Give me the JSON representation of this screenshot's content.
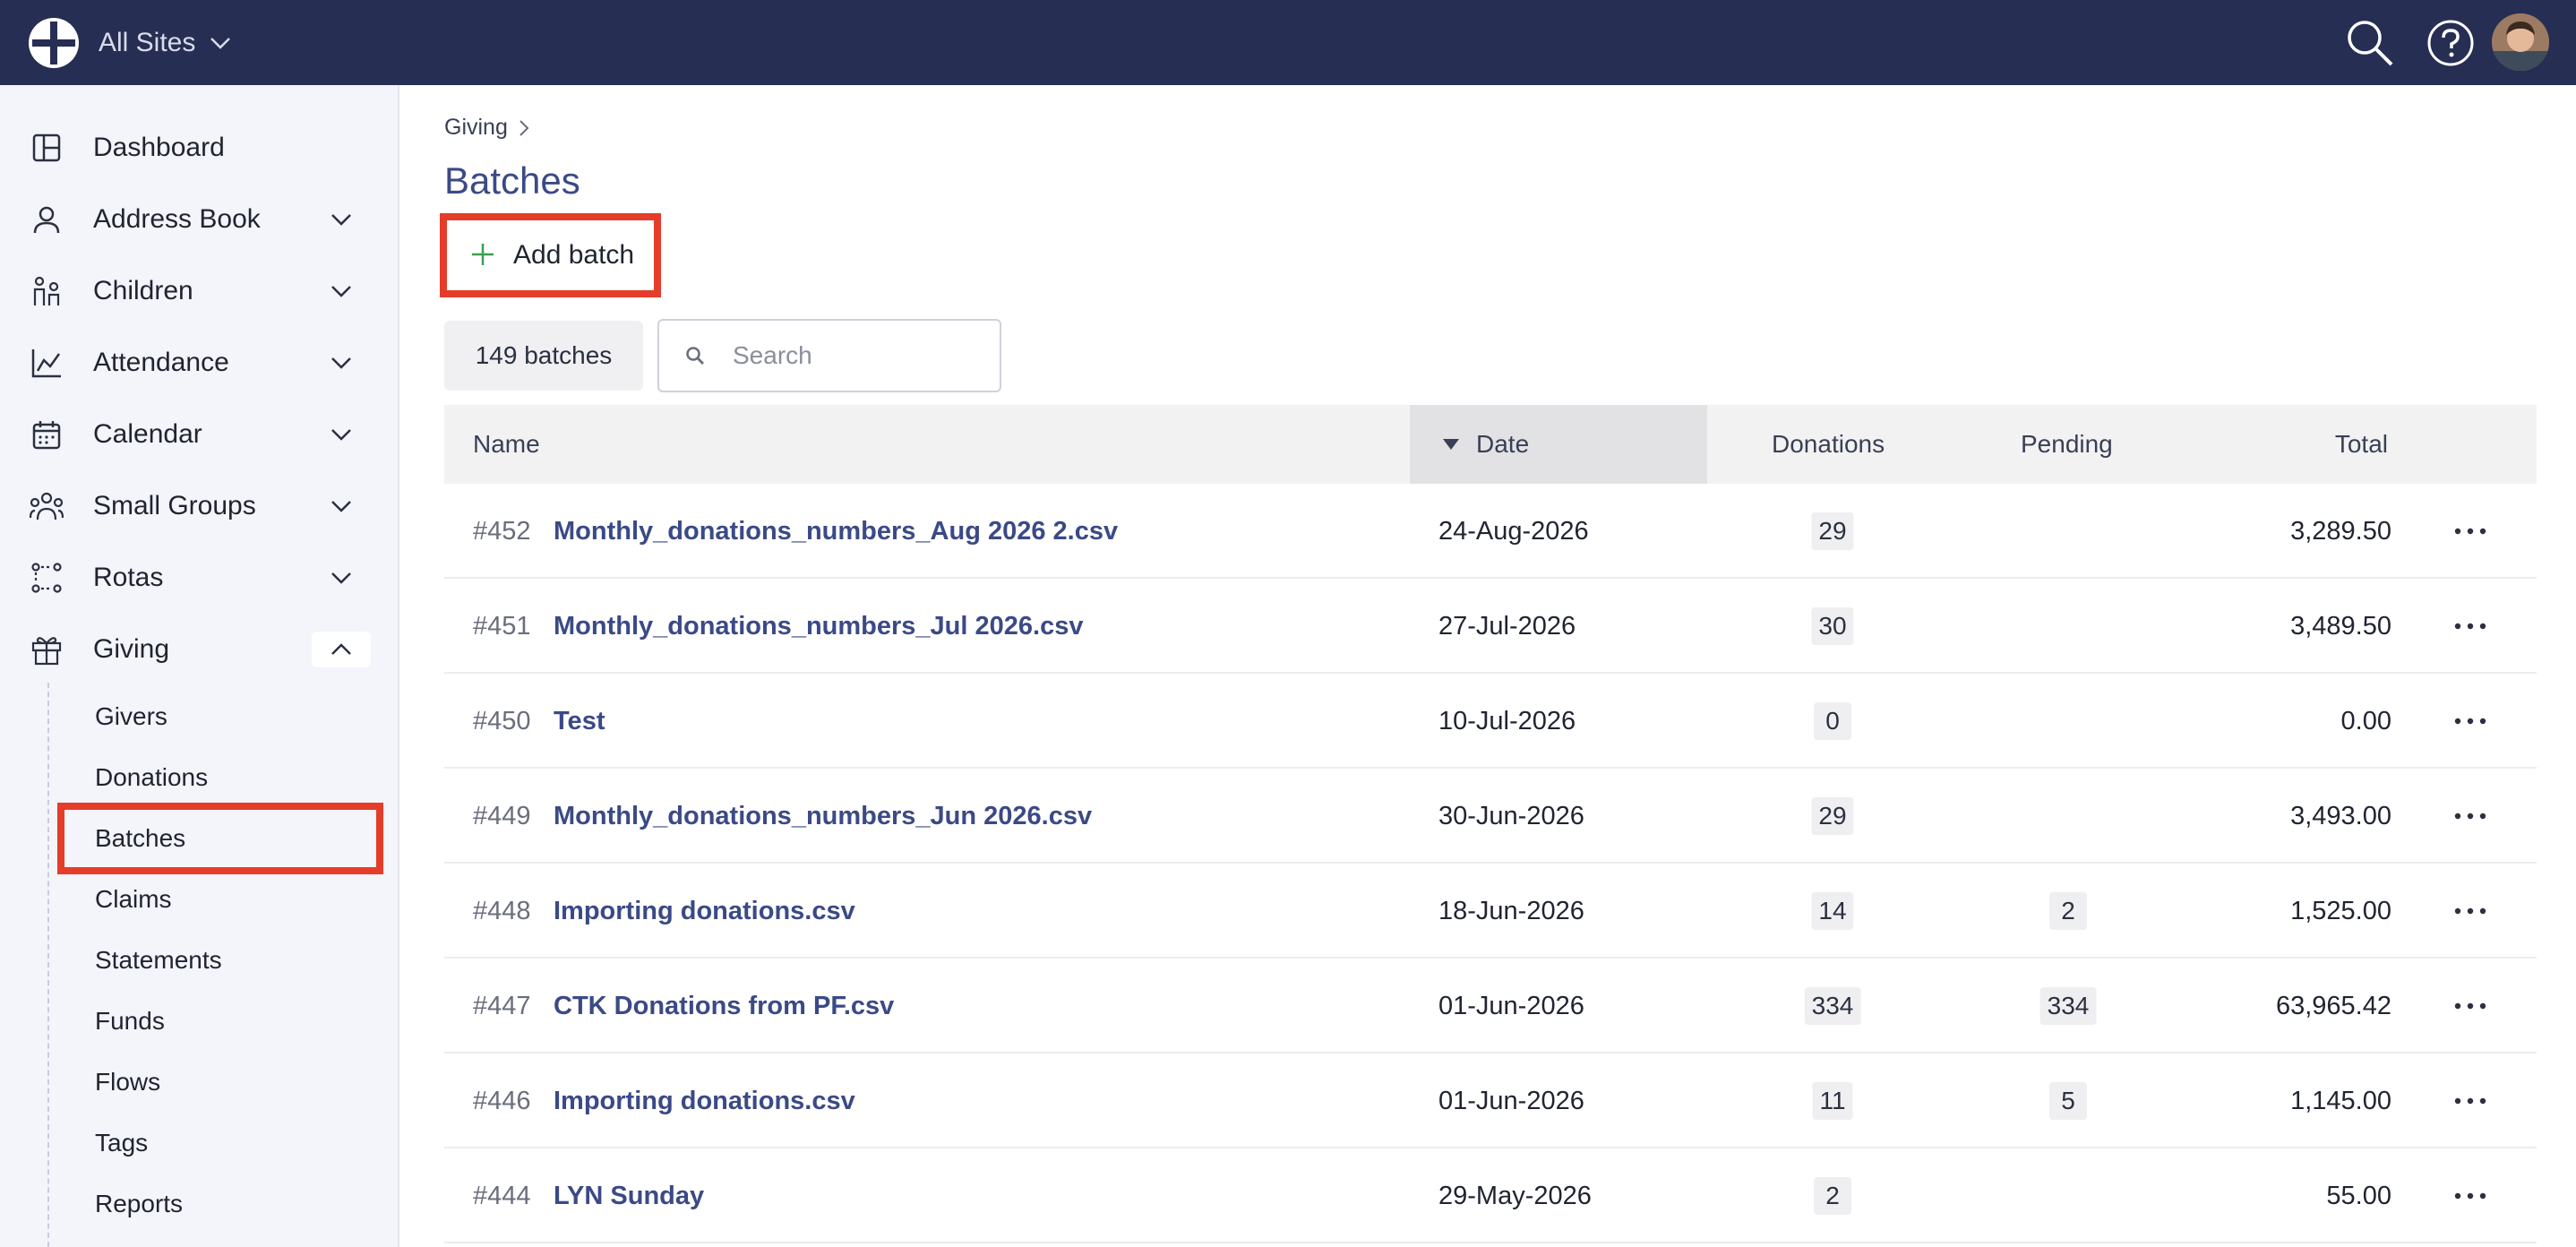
{
  "header": {
    "site_selector": "All Sites"
  },
  "sidebar": {
    "items": [
      {
        "label": "Dashboard"
      },
      {
        "label": "Address Book"
      },
      {
        "label": "Children"
      },
      {
        "label": "Attendance"
      },
      {
        "label": "Calendar"
      },
      {
        "label": "Small Groups"
      },
      {
        "label": "Rotas"
      },
      {
        "label": "Giving"
      }
    ],
    "giving_sub": [
      "Givers",
      "Donations",
      "Batches",
      "Claims",
      "Statements",
      "Funds",
      "Flows",
      "Tags",
      "Reports"
    ],
    "active_sub": "Batches"
  },
  "breadcrumb": "Giving",
  "page_title": "Batches",
  "toolbar": {
    "add_label": "Add batch",
    "count_label": "149 batches",
    "search_placeholder": "Search"
  },
  "table": {
    "columns": [
      "Name",
      "Date",
      "Donations",
      "Pending",
      "Total"
    ],
    "sort": {
      "column": "Date",
      "direction": "desc"
    },
    "rows": [
      {
        "id": "#452",
        "name": "Monthly_donations_numbers_Aug 2026 2.csv",
        "date": "24-Aug-2026",
        "donations": "29",
        "pending": "",
        "total": "3,289.50"
      },
      {
        "id": "#451",
        "name": "Monthly_donations_numbers_Jul 2026.csv",
        "date": "27-Jul-2026",
        "donations": "30",
        "pending": "",
        "total": "3,489.50"
      },
      {
        "id": "#450",
        "name": "Test",
        "date": "10-Jul-2026",
        "donations": "0",
        "pending": "",
        "total": "0.00"
      },
      {
        "id": "#449",
        "name": "Monthly_donations_numbers_Jun 2026.csv",
        "date": "30-Jun-2026",
        "donations": "29",
        "pending": "",
        "total": "3,493.00"
      },
      {
        "id": "#448",
        "name": "Importing donations.csv",
        "date": "18-Jun-2026",
        "donations": "14",
        "pending": "2",
        "total": "1,525.00"
      },
      {
        "id": "#447",
        "name": "CTK Donations from PF.csv",
        "date": "01-Jun-2026",
        "donations": "334",
        "pending": "334",
        "total": "63,965.42"
      },
      {
        "id": "#446",
        "name": "Importing donations.csv",
        "date": "01-Jun-2026",
        "donations": "11",
        "pending": "5",
        "total": "1,145.00"
      },
      {
        "id": "#444",
        "name": "LYN Sunday",
        "date": "29-May-2026",
        "donations": "2",
        "pending": "",
        "total": "55.00"
      }
    ]
  },
  "colors": {
    "topbar": "#272e54",
    "accent": "#3b4a86",
    "highlight": "#e43d2a",
    "plus": "#3aa14b"
  }
}
